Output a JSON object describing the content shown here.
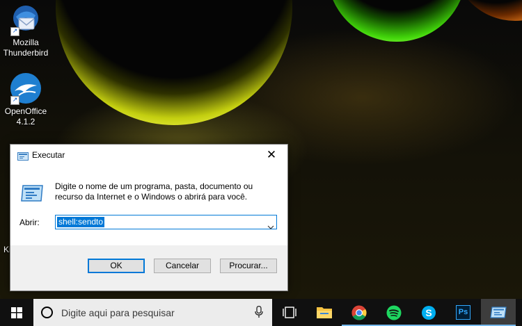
{
  "desktop": {
    "icons": [
      {
        "label_line1": "Mozilla",
        "label_line2": "Thunderbird",
        "icon": "thunderbird-icon"
      },
      {
        "label_line1": "OpenOffice",
        "label_line2": "4.1.2",
        "icon": "openoffice-icon"
      }
    ],
    "partial_label": "Ki"
  },
  "dialog": {
    "title": "Executar",
    "instruction_line1": "Digite o nome de um programa, pasta, documento ou",
    "instruction_line2": "recurso da Internet e o Windows o abrirá para você.",
    "open_label": "Abrir:",
    "open_value": "shell:sendto",
    "ok_label": "OK",
    "cancel_label": "Cancelar",
    "browse_label": "Procurar..."
  },
  "taskbar": {
    "search_placeholder": "Digite aqui para pesquisar",
    "apps": [
      "task-view-icon",
      "file-explorer-icon",
      "chrome-icon",
      "spotify-icon",
      "skype-icon",
      "photoshop-icon",
      "run-icon"
    ],
    "photoshop_text": "Ps",
    "accent": "#76b9ed"
  }
}
